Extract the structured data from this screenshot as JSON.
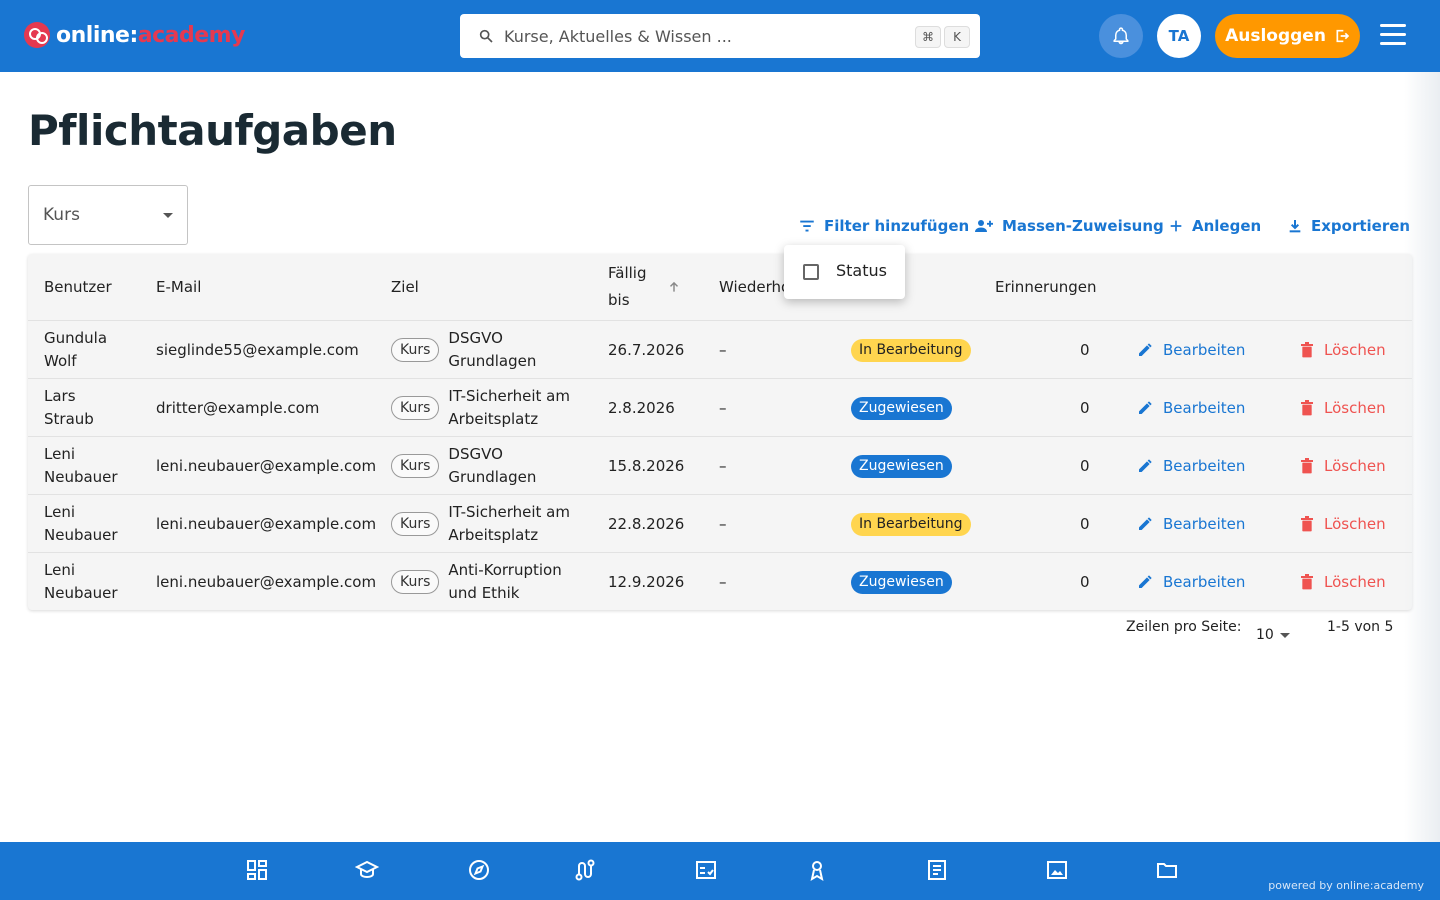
{
  "header": {
    "logo_main": "online:",
    "logo_accent": "academy",
    "search_placeholder": "Kurse, Aktuelles & Wissen ...",
    "shortcut_cmd": "⌘",
    "shortcut_key": "K",
    "avatar_initials": "TA",
    "logout_label": "Ausloggen"
  },
  "page": {
    "title": "Pflichtaufgaben",
    "kurs_select_label": "Kurs"
  },
  "toolbar": {
    "filter_label": "Filter hinzufügen",
    "mass_label": "Massen-Zuweisung",
    "add_label": "Anlegen",
    "export_label": "Exportieren"
  },
  "filter_popover": {
    "option_label": "Status"
  },
  "table": {
    "headers": {
      "user": "Benutzer",
      "email": "E-Mail",
      "goal": "Ziel",
      "due_line1": "Fällig",
      "due_line2": "bis",
      "repeat": "Wiederho",
      "reminders": "Erinnerungen"
    },
    "rows": [
      {
        "user_l1": "Gundula",
        "user_l2": "Wolf",
        "email": "sieglinde55@example.com",
        "chip": "Kurs",
        "goal_l1": "DSGVO",
        "goal_l2": "Grundlagen",
        "due": "26.7.2026",
        "repeat": "–",
        "status": "In Bearbeitung",
        "reminders": "0",
        "edit": "Bearbeiten",
        "delete": "Löschen"
      },
      {
        "user_l1": "Lars",
        "user_l2": "Straub",
        "email": "dritter@example.com",
        "chip": "Kurs",
        "goal_l1": "IT-Sicherheit am",
        "goal_l2": "Arbeitsplatz",
        "due": "2.8.2026",
        "repeat": "–",
        "status": "Zugewiesen",
        "reminders": "0",
        "edit": "Bearbeiten",
        "delete": "Löschen"
      },
      {
        "user_l1": "Leni",
        "user_l2": "Neubauer",
        "email": "leni.neubauer@example.com",
        "chip": "Kurs",
        "goal_l1": "DSGVO",
        "goal_l2": "Grundlagen",
        "due": "15.8.2026",
        "repeat": "–",
        "status": "Zugewiesen",
        "reminders": "0",
        "edit": "Bearbeiten",
        "delete": "Löschen"
      },
      {
        "user_l1": "Leni",
        "user_l2": "Neubauer",
        "email": "leni.neubauer@example.com",
        "chip": "Kurs",
        "goal_l1": "IT-Sicherheit am",
        "goal_l2": "Arbeitsplatz",
        "due": "22.8.2026",
        "repeat": "–",
        "status": "In Bearbeitung",
        "reminders": "0",
        "edit": "Bearbeiten",
        "delete": "Löschen"
      },
      {
        "user_l1": "Leni",
        "user_l2": "Neubauer",
        "email": "leni.neubauer@example.com",
        "chip": "Kurs",
        "goal_l1": "Anti-Korruption",
        "goal_l2": "und Ethik",
        "due": "12.9.2026",
        "repeat": "–",
        "status": "Zugewiesen",
        "reminders": "0",
        "edit": "Bearbeiten",
        "delete": "Löschen"
      }
    ]
  },
  "pagination": {
    "rows_label": "Zeilen pro Seite:",
    "rows_value": "10",
    "range": "1-5 von 5"
  },
  "footer": {
    "powered": "powered by online:academy",
    "nav_icons": [
      "dashboard-icon",
      "graduation-cap-icon",
      "compass-icon",
      "route-icon",
      "checklist-icon",
      "award-icon",
      "article-icon",
      "image-icon",
      "folder-icon"
    ]
  },
  "colors": {
    "primary": "#1976d2",
    "accent": "#ff9800",
    "brand_red": "#e53950",
    "status_in_progress": "#ffd54f",
    "status_assigned": "#1976d2",
    "delete": "#ef5350"
  }
}
